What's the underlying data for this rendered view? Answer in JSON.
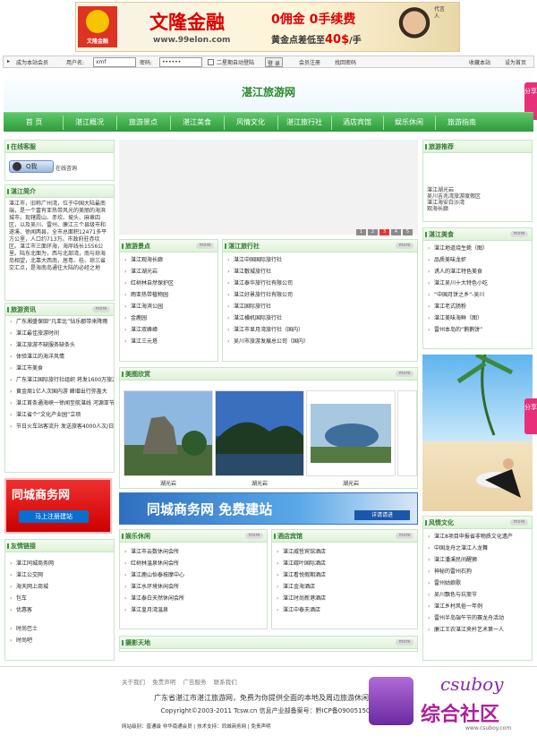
{
  "banner": {
    "brand": "文隆金融",
    "logo_text": "文隆金融",
    "url": "www.99elon.com",
    "offer1": "0佣金  0手续费",
    "offer2_prefix": "黄金点差低至",
    "offer2_amount": "40$",
    "offer2_suffix": "/手",
    "side_text": "代言人"
  },
  "loginbar": {
    "join": "成为本站会员",
    "user_label": "用户名:",
    "user_value": "xmf",
    "pass_label": "密码:",
    "pass_value": "••••••",
    "remember": "二星期自动登陆",
    "login_btn": "登 录",
    "register": "会员注册",
    "forgot": "找回密码",
    "bookmark": "收藏本站",
    "homepage": "设为首页"
  },
  "site": {
    "title": "湛江旅游网"
  },
  "nav": [
    "首 页",
    "湛江概况",
    "旅游景点",
    "湛江美食",
    "风情文化",
    "湛江旅行社",
    "酒店宾馆",
    "娱乐休闲",
    "旅游指南"
  ],
  "sidetab": "分享",
  "left": {
    "service_title": "在线客服",
    "qq_label": "Q我",
    "qq_text": "在线咨询",
    "intro_title": "湛江简介",
    "intro_text": "湛江市，旧称广州湾，位于中国大陆最南端，是一个富有亚热带风光的美丽的海滨城市。现辖霞山、赤坎、坡头、麻章四区，以及吴川、雷州、廉江三个县级市和遂溪、徐闻两县，全市总面积12471多平方公里，人口约713万。市政府驻赤坎区。湛江市三面环海，海岸线长1556公里。陆东北面为，西与北部湾，南与琼海岛相望，北靠大西南，居粤、桂、琼三省交汇点，是海南岛通往大陆的必经之地",
    "news_title": "旅游资讯",
    "news": [
      "广东湘盛保田“凡亚比”钻乐郡带来降雨",
      "湛江最佳旅游时间",
      "湛江旅游不缺服务缺条头",
      "体验湛江的海洋风情",
      "湛江市美食",
      "广东湛江国际旅行社组织 将发1600万旅游券",
      "黄金周1亿人次国内游 峰增出行弥盖大",
      "湛江首条通海峡一徐闻至航湛线 河源亚节将可以开通",
      "湛江省个“文化产业园”立项",
      "节日火车站客流升 发送旅客4000人次/日"
    ],
    "ad_title": "同城商务网",
    "ad_btn": "马上注册建站",
    "links_title": "友情链接",
    "links": [
      "湛江同城商务网",
      "湛江公交网",
      "海天网上商城",
      "包车",
      "优惠客"
    ],
    "links2": [
      "时尚巴士",
      "时尚吧"
    ]
  },
  "mid": {
    "scenic_title": "旅游景点",
    "scenic": [
      "湛江观海长廊",
      "湛江湖光岩",
      "红树林自然保护区",
      "雨亚热带植物园",
      "湛江海滨公园",
      "金鹿园",
      "湛江双峰嶂",
      "湛江三元塔"
    ],
    "agency_title": "湛江旅行社",
    "agency": [
      "湛江中国国际旅行社",
      "湛江敷城旅行社",
      "湛江泰华旅行社有限公司",
      "湛江好景旅行社有限公司",
      "湛江国际旅行社",
      "湛江横机国际旅行社",
      "湛江市显月湾旅行社（国内）",
      "吴川市旅游发展总公司（国内）"
    ],
    "gallery_title": "美图欣赏",
    "gallery": [
      "湖光岩",
      "湖光岩",
      "湖光岩"
    ],
    "ad2_text": "同城商务网 免费建站",
    "ad2_link": "详请请进",
    "fun_title": "娱乐休闲",
    "fun": [
      "湛江市云数休闲会所",
      "红树林温泉休闲会所",
      "湛江鹿山怡泰按摩中心",
      "湛江水环境休闲会所",
      "湛江泰白天然休闲会所",
      "湛江皇月湾温泉"
    ],
    "hotel_title": "酒店宾馆",
    "hotel": [
      "湛江威哲宾馆酒店",
      "湛江碳叶国际酒店",
      "湛江看悦假期酒店",
      "湛江金海酒店",
      "湛江时尚新港酒店",
      "湛江中泰夫酒店"
    ],
    "photo_title": "摄影天地",
    "dots": [
      "1",
      "2",
      "3",
      "4",
      "5"
    ],
    "more": "more"
  },
  "right": {
    "rec_title": "旅游推荐",
    "rec": [
      "湛江湖光岩",
      "吴川吉兆湾旅游度假区",
      "湛江海安白沙湾",
      "观海长廊"
    ],
    "food_title": "湛江美食",
    "food": [
      "湛江地道烧生蚝（图）",
      "品质美味龙虾",
      "诱人的湛江特色美食",
      "湛江吴川十大特色小吃",
      "“中国月饼之乡”-吴川",
      "湛江老式肠粉",
      "湛江美味海鲜（图）",
      "雷州本岛的“鹅鹅饼”"
    ],
    "culture_title": "风情文化",
    "culture": [
      "湛江8项目申报省非物质文化遗产",
      "中国龙舟之湛江人龙舞",
      "湛江潘溪民间醒狮",
      "神秘的雷州石狗",
      "雷州姑娘歌",
      "吴川飘色与坑斋节",
      "湛江乡村风俗一年例",
      "雷州半岛端午节的赛龙舟活动",
      "廉江王农湛江夹杆艺术第一人"
    ]
  },
  "footer": {
    "links": [
      "关于我们",
      "免责声明",
      "广告服务",
      "联系我们"
    ],
    "line2": "广东省湛江市湛江旅游网，免费为你提供全面的本地及周边旅游休闲信息",
    "line3": "Copyright©2003-2011 Tcsw.cn 信息产业部备案号：黔ICP备09005150号",
    "line4": "网站级别：普通级  非华南通会员  |  技术支持：同城商务网  |  免责声明"
  },
  "watermark": {
    "line1": "csuboy",
    "line2": "综合社区",
    "line3": "www.csuboy.com"
  },
  "colors": {
    "nav_green": "#2e9a3a",
    "title_green": "#2a8a2a",
    "accent_red": "#d00"
  }
}
